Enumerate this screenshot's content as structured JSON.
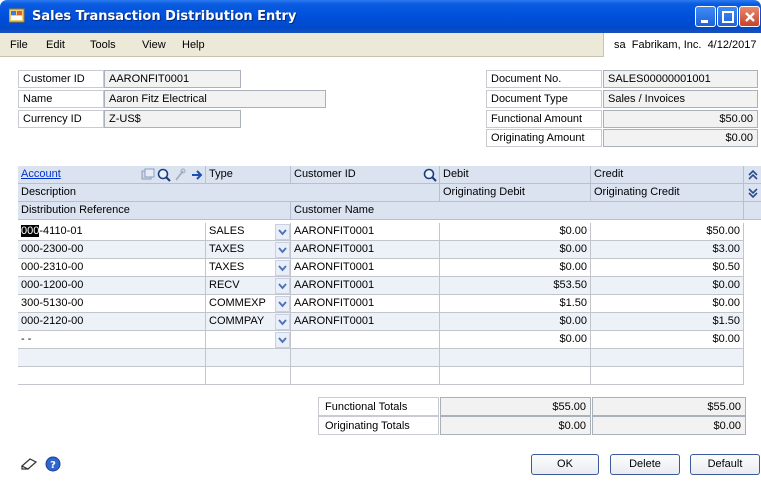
{
  "window": {
    "title": "Sales Transaction Distribution Entry",
    "controls": {
      "minimize": "minimize",
      "maximize": "maximize",
      "close": "close"
    }
  },
  "menu": {
    "items": [
      "File",
      "Edit",
      "Tools",
      "View",
      "Help"
    ],
    "user": "sa",
    "company": "Fabrikam, Inc.",
    "date": "4/12/2017"
  },
  "header_left": {
    "customer_id": {
      "label": "Customer ID",
      "value": "AARONFIT0001"
    },
    "name": {
      "label": "Name",
      "value": "Aaron Fitz Electrical"
    },
    "currency_id": {
      "label": "Currency ID",
      "value": "Z-US$"
    }
  },
  "header_right": {
    "document_no": {
      "label": "Document No.",
      "value": "SALES00000001001"
    },
    "document_type": {
      "label": "Document Type",
      "value": "Sales / Invoices"
    },
    "functional_amount": {
      "label": "Functional Amount",
      "value": "$50.00"
    },
    "originating_amount": {
      "label": "Originating Amount",
      "value": "$0.00"
    }
  },
  "grid": {
    "headers_row1": {
      "account": "Account",
      "type": "Type",
      "customer_id": "Customer ID",
      "debit": "Debit",
      "credit": "Credit"
    },
    "headers_row2": {
      "description": "Description",
      "originating_debit": "Originating Debit",
      "originating_credit": "Originating Credit"
    },
    "headers_row3": {
      "distribution_reference": "Distribution Reference",
      "customer_name": "Customer Name"
    },
    "rows": [
      {
        "account_seg1": "000",
        "account_rest": "-4110-01",
        "type": "SALES",
        "customer_id": "AARONFIT0001",
        "debit": "$0.00",
        "credit": "$50.00"
      },
      {
        "account_seg1": "",
        "account_rest": "000-2300-00",
        "type": "TAXES",
        "customer_id": "AARONFIT0001",
        "debit": "$0.00",
        "credit": "$3.00"
      },
      {
        "account_seg1": "",
        "account_rest": "000-2310-00",
        "type": "TAXES",
        "customer_id": "AARONFIT0001",
        "debit": "$0.00",
        "credit": "$0.50"
      },
      {
        "account_seg1": "",
        "account_rest": "000-1200-00",
        "type": "RECV",
        "customer_id": "AARONFIT0001",
        "debit": "$53.50",
        "credit": "$0.00"
      },
      {
        "account_seg1": "",
        "account_rest": "300-5130-00",
        "type": "COMMEXP",
        "customer_id": "AARONFIT0001",
        "debit": "$1.50",
        "credit": "$0.00"
      },
      {
        "account_seg1": "",
        "account_rest": "000-2120-00",
        "type": "COMMPAY",
        "customer_id": "AARONFIT0001",
        "debit": "$0.00",
        "credit": "$1.50"
      },
      {
        "account_seg1": "",
        "account_rest": " -       -",
        "type": "",
        "customer_id": "",
        "debit": "$0.00",
        "credit": "$0.00"
      }
    ]
  },
  "totals": {
    "functional": {
      "label": "Functional Totals",
      "debit": "$55.00",
      "credit": "$55.00"
    },
    "originating": {
      "label": "Originating Totals",
      "debit": "$0.00",
      "credit": "$0.00"
    }
  },
  "buttons": {
    "ok": "OK",
    "delete": "Delete",
    "default": "Default"
  },
  "icons": {
    "window": "window-icon",
    "note": "note-icon",
    "help": "help-icon"
  }
}
